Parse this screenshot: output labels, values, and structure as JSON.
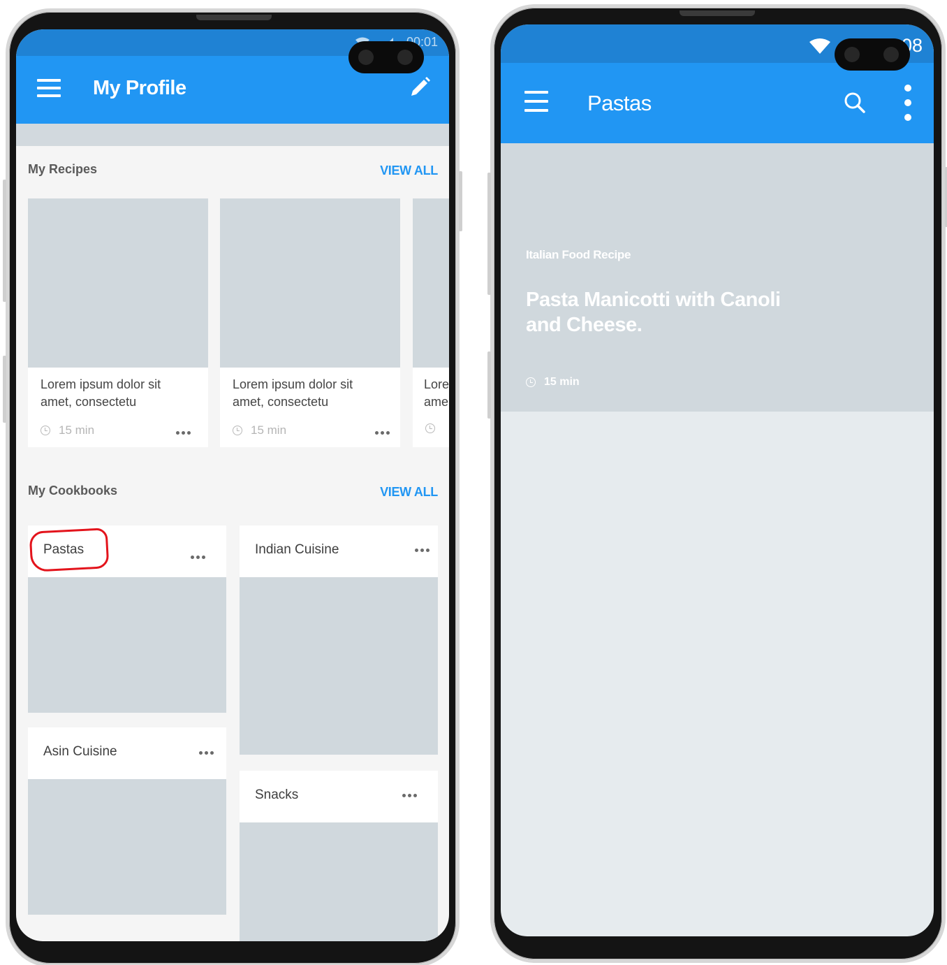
{
  "left_screen": {
    "status_time": "00:01",
    "title": "My Profile",
    "edit_icon": "pencil-icon",
    "menu_icon": "hamburger-menu-icon",
    "my_recipes": {
      "title": "My Recipes",
      "view_all": "VIEW ALL",
      "cards": [
        {
          "line1": "Lorem ipsum dolor sit",
          "line2": "amet, consectetu",
          "time": "15 min"
        },
        {
          "line1": "Lorem ipsum dolor sit",
          "line2": "amet, consectetu",
          "time": "15 min"
        },
        {
          "line1": "Lore",
          "line2": "ame",
          "time": ""
        }
      ]
    },
    "my_cookbooks": {
      "title": "My Cookbooks",
      "view_all": "VIEW ALL",
      "items": [
        {
          "label": "Pastas"
        },
        {
          "label": "Indian Cuisine"
        },
        {
          "label": "Asin Cuisine"
        },
        {
          "label": "Snacks"
        }
      ]
    },
    "annotation_color": "#e3141c"
  },
  "right_screen": {
    "status_time": "00:08",
    "title": "Pastas",
    "search_icon": "search-icon",
    "more_icon": "more-vertical-icon",
    "hero": {
      "subtitle": "Italian Food Recipe",
      "title_line1": "Pasta Manicotti with Canoli",
      "title_line2": "and Cheese.",
      "time": "15 min"
    }
  },
  "colors": {
    "toolbar": "#2196f3",
    "statusbar": "#1f82d4",
    "accent": "#2196f3",
    "placeholder": "#d0d8dd"
  }
}
